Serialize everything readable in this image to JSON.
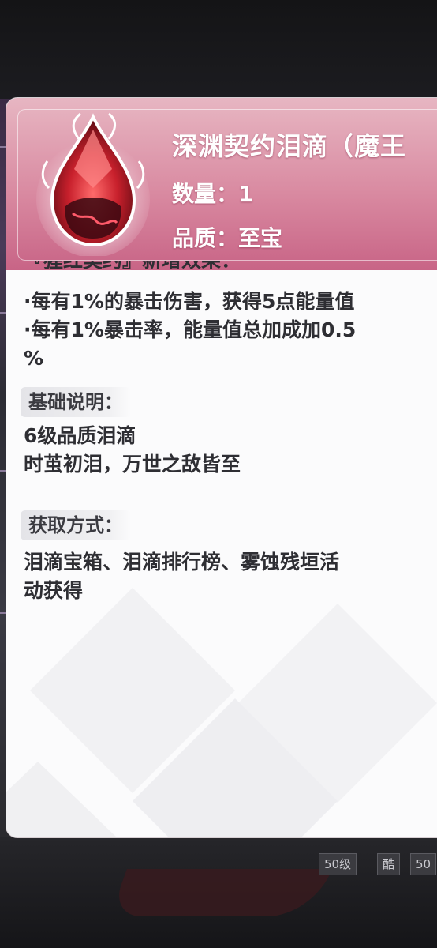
{
  "item": {
    "title": "深渊契约泪滴（魔王",
    "quantity_label": "数量：1",
    "quality_label": "品质：至宝"
  },
  "effects": {
    "cut_header": "『猩红契约』新增效果：",
    "lines": [
      "·每有1%的暴击伤害，获得5点能量值",
      "·每有1%暴击率，能量值总加成加0.5",
      "%"
    ]
  },
  "basic": {
    "heading": "基础说明：",
    "lines": [
      "6级品质泪滴",
      "时茧初泪，万世之敌皆至"
    ]
  },
  "obtain": {
    "heading": "获取方式：",
    "lines": [
      "泪滴宝箱、泪滴排行榜、雾蚀残垣活",
      "动获得"
    ]
  },
  "background": {
    "badges": [
      "50级",
      "酷",
      "50"
    ]
  },
  "colors": {
    "header_top": "#e7b6c2",
    "header_bottom": "#c86486",
    "gem_red": "#c8202c",
    "text_dark": "#2e2e33"
  }
}
